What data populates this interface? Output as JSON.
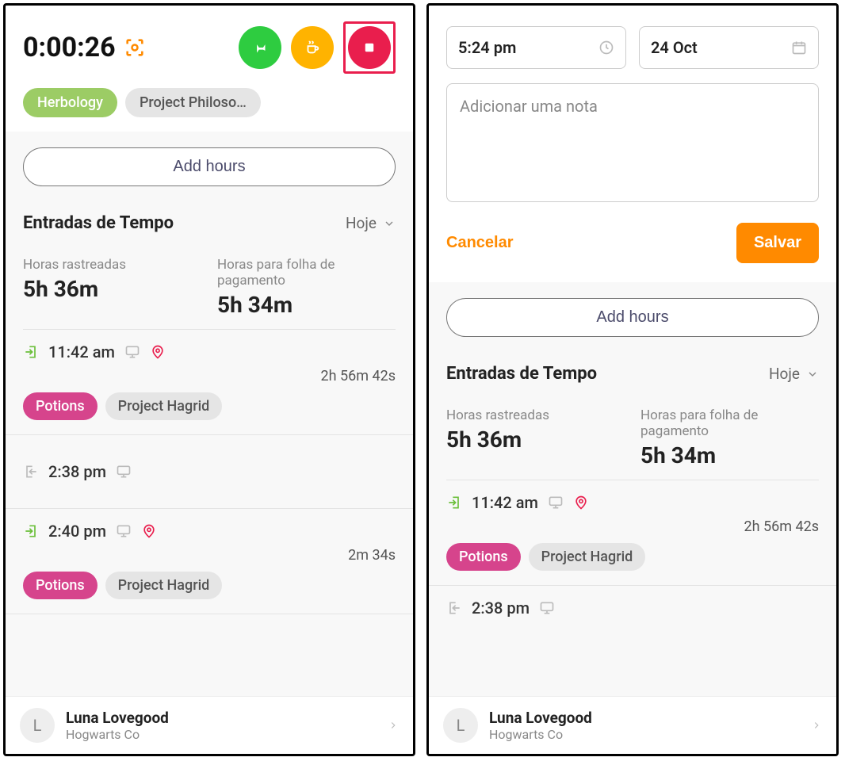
{
  "left": {
    "timer": "0:00:26",
    "tags": {
      "primary": "Herbology",
      "secondary": "Project Philoso…"
    },
    "add_hours": "Add hours",
    "entries_header": "Entradas de Tempo",
    "filter_label": "Hoje",
    "totals": {
      "tracked_label": "Horas rastreadas",
      "tracked_value": "5h 36m",
      "payroll_label": "Horas para folha de pagamento",
      "payroll_value": "5h 34m"
    },
    "entry1": {
      "time": "11:42 am",
      "duration": "2h 56m 42s",
      "tag1": "Potions",
      "tag2": "Project Hagrid"
    },
    "entry2": {
      "time": "2:38 pm"
    },
    "entry3": {
      "time": "2:40 pm",
      "duration": "2m 34s",
      "tag1": "Potions",
      "tag2": "Project Hagrid"
    },
    "user": {
      "initial": "L",
      "name": "Luna Lovegood",
      "org": "Hogwarts Co"
    }
  },
  "right": {
    "time_field": "5:24 pm",
    "date_field": "24 Oct",
    "note_placeholder": "Adicionar uma nota",
    "cancel": "Cancelar",
    "save": "Salvar",
    "add_hours": "Add hours",
    "entries_header": "Entradas de Tempo",
    "filter_label": "Hoje",
    "totals": {
      "tracked_label": "Horas rastreadas",
      "tracked_value": "5h 36m",
      "payroll_label": "Horas para folha de pagamento",
      "payroll_value": "5h 34m"
    },
    "entry1": {
      "time": "11:42 am",
      "duration": "2h 56m 42s",
      "tag1": "Potions",
      "tag2": "Project Hagrid"
    },
    "entry2": {
      "time": "2:38 pm"
    },
    "user": {
      "initial": "L",
      "name": "Luna Lovegood",
      "org": "Hogwarts Co"
    }
  }
}
